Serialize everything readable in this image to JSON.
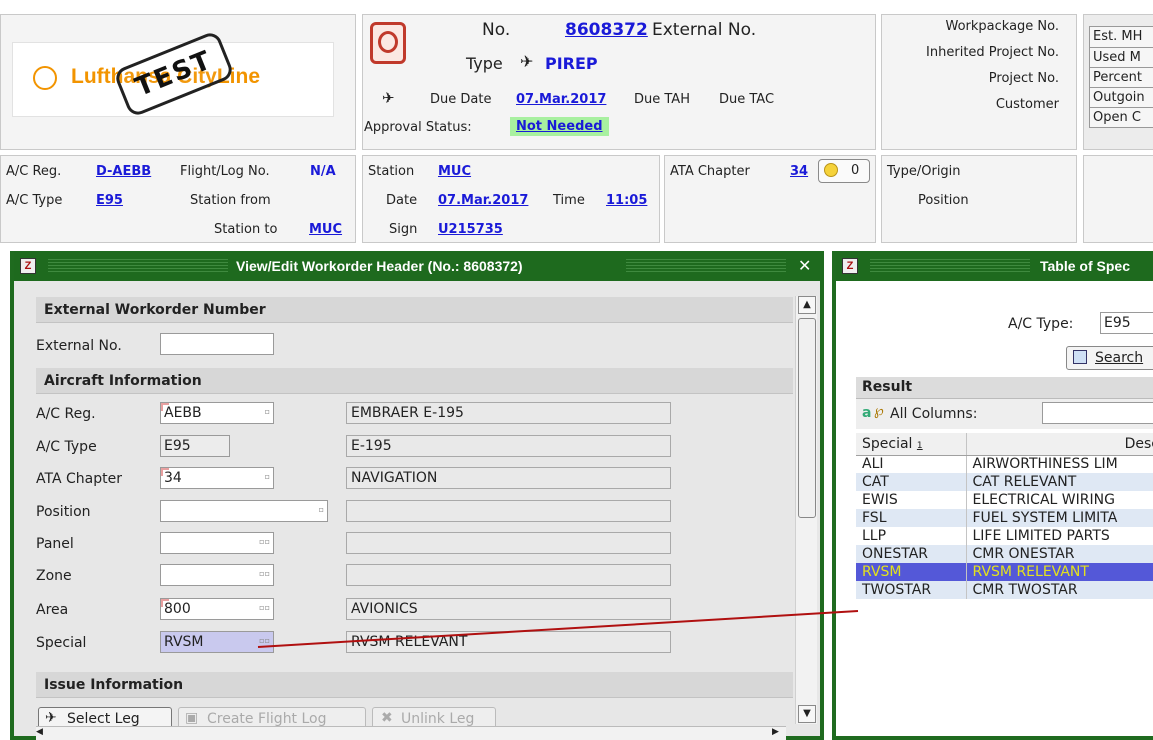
{
  "header": {
    "logo_text": "Lufthansa CityLine",
    "logo_stamp": "TEST",
    "no_label": "No.",
    "no_value": "8608372",
    "external_no_label": "External No.",
    "type_label": "Type",
    "type_value": "PIREP",
    "due_date_label": "Due Date",
    "due_date_value": "07.Mar.2017",
    "due_tah_label": "Due TAH",
    "due_tac_label": "Due TAC",
    "approval_label": "Approval Status:",
    "approval_value": "Not Needed",
    "workpackage_label": "Workpackage No.",
    "inherited_project_label": "Inherited Project No.",
    "project_label": "Project No.",
    "customer_label": "Customer",
    "stats_labels": [
      "Est. MH",
      "Used M",
      "Percent",
      "Outgoin",
      "Open C"
    ]
  },
  "info_row": {
    "ac_reg_label": "A/C Reg.",
    "ac_reg_value": "D-AEBB",
    "flight_log_label": "Flight/Log No.",
    "flight_log_value": "N/A",
    "ac_type_label": "A/C Type",
    "ac_type_value": "E95",
    "station_from_label": "Station from",
    "station_to_label": "Station to",
    "station_to_value": "MUC",
    "station_label": "Station",
    "station_value": "MUC",
    "date_label": "Date",
    "date_value": "07.Mar.2017",
    "time_label": "Time",
    "time_value": "11:05",
    "sign_label": "Sign",
    "sign_value": "U215735",
    "ata_label": "ATA Chapter",
    "ata_value": "34",
    "hint_count": "0",
    "type_origin_label": "Type/Origin",
    "position_label": "Position"
  },
  "workorder_window": {
    "title": "View/Edit Workorder Header (No.: 8608372)",
    "close_glyph": "✕",
    "sections": {
      "external": "External Workorder Number",
      "aircraft": "Aircraft Information",
      "issue": "Issue Information"
    },
    "fields": {
      "external_no": {
        "label": "External No.",
        "value": ""
      },
      "ac_reg": {
        "label": "A/C Reg.",
        "value": "AEBB",
        "display": "EMBRAER E-195"
      },
      "ac_type": {
        "label": "A/C Type",
        "value": "E95",
        "display": "E-195"
      },
      "ata": {
        "label": "ATA Chapter",
        "value": "34",
        "display": "NAVIGATION"
      },
      "position": {
        "label": "Position",
        "value": "",
        "display": ""
      },
      "panel": {
        "label": "Panel",
        "value": "",
        "display": ""
      },
      "zone": {
        "label": "Zone",
        "value": "",
        "display": ""
      },
      "area": {
        "label": "Area",
        "value": "800",
        "display": "AVIONICS"
      },
      "special": {
        "label": "Special",
        "value": "RVSM",
        "display": "RVSM RELEVANT"
      }
    },
    "buttons": {
      "select_leg": "Select Leg",
      "create_flight_log": "Create Flight Log",
      "unlink_leg": "Unlink Leg"
    }
  },
  "spec_window": {
    "title": "Table of Spec",
    "ac_type_label": "A/C Type:",
    "ac_type_value": "E95",
    "search_label": "Search",
    "result_label": "Result",
    "all_columns_label": "All Columns:",
    "columns": [
      "Special",
      "Desc"
    ],
    "sort_indicator": "1",
    "rows": [
      {
        "code": "ALI",
        "desc": "AIRWORTHINESS LIM"
      },
      {
        "code": "CAT",
        "desc": "CAT RELEVANT"
      },
      {
        "code": "EWIS",
        "desc": "ELECTRICAL WIRING"
      },
      {
        "code": "FSL",
        "desc": "FUEL SYSTEM LIMITA"
      },
      {
        "code": "LLP",
        "desc": "LIFE LIMITED PARTS"
      },
      {
        "code": "ONESTAR",
        "desc": "CMR ONESTAR"
      },
      {
        "code": "RVSM",
        "desc": "RVSM RELEVANT"
      },
      {
        "code": "TWOSTAR",
        "desc": "CMR TWOSTAR"
      }
    ],
    "selected_row": "RVSM"
  },
  "colors": {
    "window_green": "#1e6a1e",
    "selected_row_bg": "#5458d8",
    "selected_row_fg": "#e4e21c",
    "approval_bg": "#a8f0a0",
    "link_blue": "#1a1ad8",
    "connector_red": "#b01010"
  }
}
